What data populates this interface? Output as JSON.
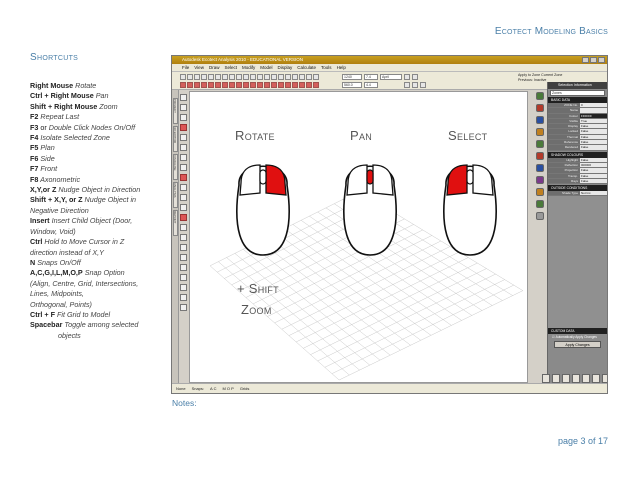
{
  "header": {
    "title": "Ecotect Modeling Basics"
  },
  "shortcuts": {
    "title": "Shortcuts",
    "items": [
      {
        "key": "Right Mouse",
        "desc": " Rotate"
      },
      {
        "key": "Ctrl + Right Mouse",
        "desc": " Pan"
      },
      {
        "key": "Shift + Right Mouse",
        "desc": " Zoom"
      },
      {
        "key": "F2",
        "desc": " Repeat Last"
      },
      {
        "key": "F3",
        "plain": " or",
        "desc": " Double Click Nodes On/Off"
      },
      {
        "key": "F4",
        "desc": " Isolate Selected Zone"
      },
      {
        "key": "F5",
        "desc": " Plan"
      },
      {
        "key": "F6",
        "desc": " Side"
      },
      {
        "key": "F7",
        "desc": " Front"
      },
      {
        "key": "F8",
        "desc": " Axonometric"
      },
      {
        "key": "X,Y,or Z",
        "desc": " Nudge Object in Direction"
      },
      {
        "key": "Shift + X,Y, or Z",
        "desc": " Nudge Object in"
      },
      {
        "key": "",
        "desc": "Negative Direction"
      },
      {
        "key": "Insert",
        "desc": " Insert Child Object (Door,"
      },
      {
        "key": "",
        "desc": "Window, Void)"
      },
      {
        "key": "Ctrl",
        "desc": " Hold to Move Cursor in Z"
      },
      {
        "key": "",
        "desc": "direction instead of X,Y"
      },
      {
        "key": "N",
        "desc": " Snaps On/Off"
      },
      {
        "key": "A,C,G,I,L,M,O,P",
        "desc": " Snap Option"
      },
      {
        "key": "",
        "desc": "(Align,   Centre, Grid, Intersections,"
      },
      {
        "key": "",
        "desc": "Lines, Midpoints,"
      },
      {
        "key": "",
        "desc": "Orthogonal, Points)"
      },
      {
        "key": "Ctrl + F",
        "desc": " Fit Grid to Model"
      },
      {
        "key": "Spacebar",
        "desc": " Toggle among selected"
      },
      {
        "key": "",
        "desc": "objects",
        "indent": true
      }
    ]
  },
  "app": {
    "title": "Autodesk Ecotect Analysis 2010 - EDUCATIONAL VERSION",
    "menu": [
      "File",
      "View",
      "Draw",
      "Select",
      "Modify",
      "Model",
      "Display",
      "Calculate",
      "Tools",
      "Help"
    ],
    "toolbar": {
      "units": "1240",
      "combo2": "7.4",
      "date": "April",
      "scale": "560.0",
      "combo5": "4.4",
      "zone_lines": [
        "Apply to Zone  Current Zone",
        "Previous:       Inactive"
      ]
    },
    "left_tabs": [
      "PROJECT",
      "3D EDITOR",
      "VISUALISE",
      "ANALYSIS",
      "REPORT"
    ],
    "status": [
      "None",
      "Snaps:",
      "A C",
      "M O P",
      "Grids"
    ],
    "right_panel": {
      "title": "Selection Information",
      "zone_combo": "Zones",
      "basic_section": "BASIC DATA",
      "basic_rows": [
        {
          "k": "ZONE No.",
          "v": "0"
        },
        {
          "k": "Name",
          "v": ""
        },
        {
          "k": "Colour",
          "v": "FFFFFF",
          "dark": true
        },
        {
          "k": "Visible",
          "v": "True"
        },
        {
          "k": "Display",
          "v": "False"
        },
        {
          "k": "Locked",
          "v": "False"
        },
        {
          "k": "Thermal",
          "v": "False"
        },
        {
          "k": "Reference",
          "v": "False"
        },
        {
          "k": "Rendered",
          "v": "False"
        }
      ],
      "shadow_section": "SHADOW COLOURS",
      "shadow_rows": [
        {
          "k": "Highlight",
          "v": "False"
        },
        {
          "k": "Reflection",
          "v": "000000"
        },
        {
          "k": "Projection",
          "v": "False"
        },
        {
          "k": "Transp.",
          "v": "False"
        },
        {
          "k": "Rays",
          "v": "False"
        }
      ],
      "outside_section": "OUTSIDE CONDITIONS",
      "outside_rows": [
        {
          "k": "Shade Type",
          "v": "Not Inc."
        }
      ],
      "custom_section": "CUSTOM DATA",
      "auto_apply": "Automatically Apply Changes",
      "apply_button": "Apply Changes"
    }
  },
  "mouse": {
    "rotate": "Rotate",
    "pan": "Pan",
    "select": "Select",
    "shift": "+ Shift",
    "zoom": "Zoom",
    "highlight_color": "#e01010"
  },
  "footer": {
    "notes": "Notes:",
    "page": "page  3 of 17"
  }
}
